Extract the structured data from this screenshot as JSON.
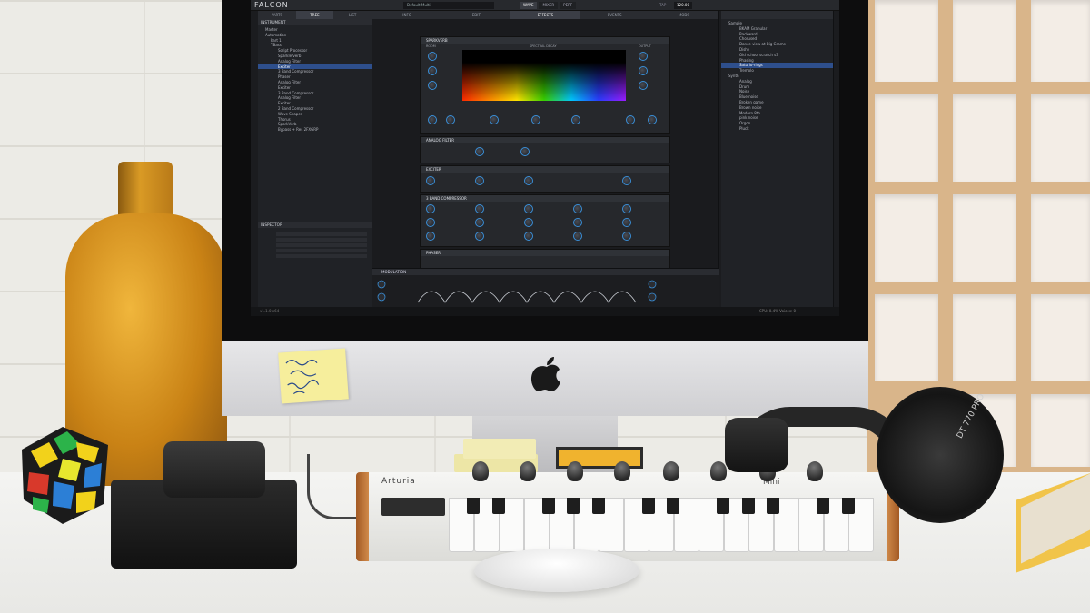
{
  "screen": {
    "app_name": "FALCON",
    "preset_name": "Default Multi",
    "top_tabs": [
      "WAVE",
      "MIXER",
      "PERF"
    ],
    "tempo_label": "TAP",
    "tempo_value": "120.00",
    "left_tabs": [
      "PARTS",
      "TREE",
      "LIST"
    ],
    "left_section": "INSTRUMENT",
    "tree": [
      "Master",
      "Automation",
      "Part 1",
      "TBass",
      "Script Processor",
      "Sparkle/verb",
      "Analog Filter",
      "Exciter",
      "3 Band Compressor",
      "Phaser",
      "Analog Filter",
      "Exciter",
      "3 Band Compressor",
      "Analog Filter",
      "Exciter",
      "2 Band Compressor",
      "Wave Shaper",
      "Thorus",
      "SparkVerb",
      "Bypass + Res 2FXGRP"
    ],
    "selected_tree_index": 7,
    "inspector_title": "INSPECTOR",
    "mid_tabs": [
      "INFO",
      "EDIT",
      "EFFECTS",
      "EVENTS",
      "MODS"
    ],
    "modules": [
      {
        "title": "SPARKVERB",
        "preset": "Tiny Room"
      },
      {
        "title": "ANALOG FILTER",
        "preset": "Default"
      },
      {
        "title": "EXCITER",
        "preset": "Default"
      },
      {
        "title": "3 BAND COMPRESSOR",
        "preset": "Default"
      },
      {
        "title": "PHASER",
        "preset": "Default"
      }
    ],
    "sparkverb_sections": [
      "ROOM",
      "SPECTRAL DECAY",
      "OUTPUT"
    ],
    "modulation_title": "MODULATION",
    "right_tree": [
      "Sample",
      "BKAM Granular",
      "Backward",
      "Chorused",
      "Dance-view at Big Grams",
      "Dishy",
      "Old school scratch s3",
      "Phasing",
      "Saturio-rings",
      "Tremolo",
      "Synth",
      "Analog",
      "Drum",
      "Noise",
      "Blue noise",
      "Broken game",
      "Brown noise",
      "Modern 8th",
      "pink noise",
      "Orgon",
      "Pluck"
    ],
    "right_selected_index": 8,
    "status_left": "v1.1.0 x64",
    "status_right": "CPU: 0.4%   Voices: 0",
    "colors": {
      "accent": "#3a8fd8",
      "selection": "#2e4f8c",
      "bg": "#1b1c1f"
    }
  },
  "keyboard": {
    "brand": "Arturia",
    "model": "Mini"
  },
  "headphones": {
    "label": "DT 770 PRO"
  },
  "objects": {
    "vase": "amber-glass-vase",
    "cube": "mirror-puzzle-cube",
    "pedal": "foot-pedal",
    "mouse": "magic-mouse",
    "note": "handwritten-sticky-note"
  }
}
